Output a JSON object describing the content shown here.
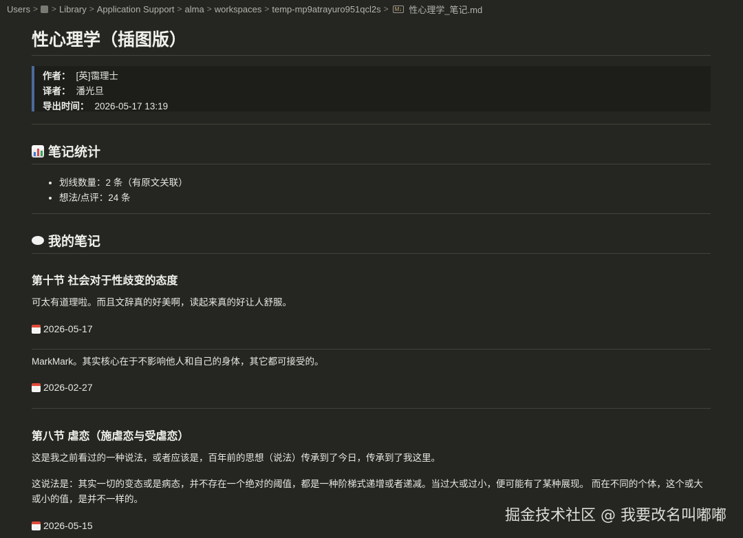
{
  "breadcrumb": {
    "items": [
      "Users",
      "Library",
      "Application Support",
      "alma",
      "workspaces",
      "temp-mp9atrayuro951qcl2s",
      "性心理学_笔记.md"
    ],
    "separator": ">"
  },
  "doc": {
    "title": "性心理学（插图版）",
    "meta": {
      "author_label": "作者：",
      "author": "[英]霭理士",
      "translator_label": "译者：",
      "translator": "潘光旦",
      "export_label": "导出时间：",
      "export_time": "2026-05-17 13:19"
    },
    "stats": {
      "heading": "笔记统计",
      "icon": "bar-chart-icon",
      "items": [
        "划线数量：2 条（有原文关联）",
        "想法/点评：24 条"
      ]
    },
    "notes": {
      "heading": "我的笔记",
      "icon": "thought-bubble-icon",
      "sections": [
        {
          "title": "第十节 社会对于性歧变的态度",
          "entries": [
            {
              "text": "可太有道理啦。而且文辞真的好美啊，读起来真的好让人舒服。",
              "date": "2026-05-17"
            },
            {
              "text": "MarkMark。其实核心在于不影响他人和自己的身体，其它都可接受的。",
              "date": "2026-02-27"
            }
          ]
        },
        {
          "title": "第八节 虐恋（施虐恋与受虐恋）",
          "paragraphs": [
            "这是我之前看过的一种说法，或者应该是，百年前的思想（说法）传承到了今日，传承到了我这里。",
            "这说法是：其实一切的变态或是病态，并不存在一个绝对的阈值，都是一种阶梯式递增或者递减。当过大或过小，便可能有了某种展现。 而在不同的个体，这个或大或小的值，是并不一样的。"
          ],
          "date": "2026-05-15"
        }
      ]
    }
  },
  "watermark": "掘金技术社区 @ 我要改名叫嘟嘟",
  "colors": {
    "background": "#252521",
    "quote_bar": "#4a6a9a",
    "text": "#e6e6e2"
  }
}
